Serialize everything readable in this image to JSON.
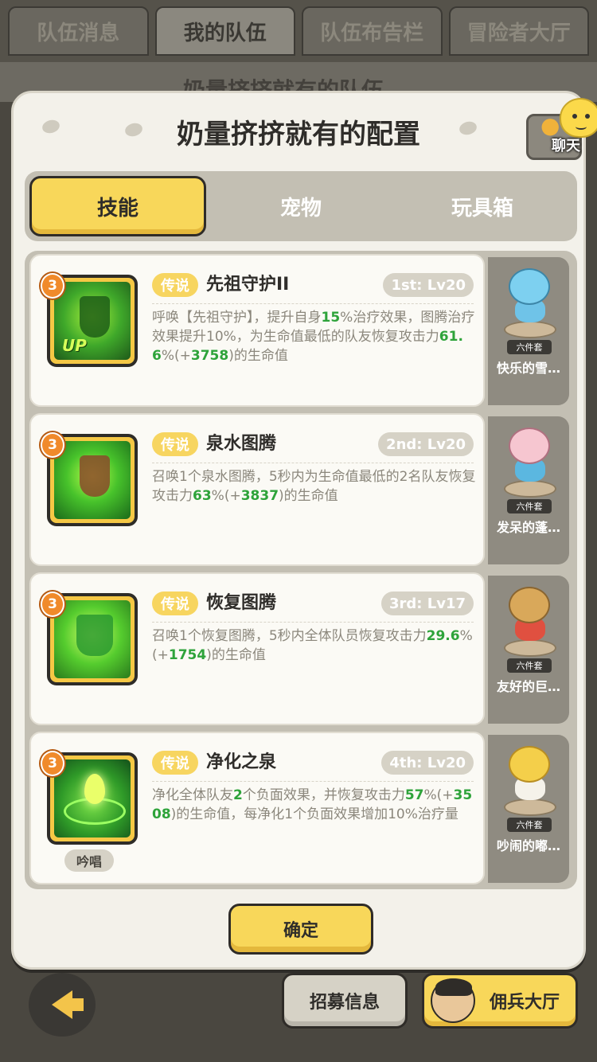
{
  "top_tabs": [
    "队伍消息",
    "我的队伍",
    "队伍布告栏",
    "冒险者大厅"
  ],
  "bg_title": "奶量挤挤就有的队伍",
  "modal": {
    "title": "奶量挤挤就有的配置",
    "chat_label": "聊天"
  },
  "segments": [
    "技能",
    "宠物",
    "玩具箱"
  ],
  "skills": [
    {
      "level": "3",
      "tag": "传说",
      "name": "先祖守护II",
      "order": "1st: Lv20",
      "icon": "ancestor-guard-icon",
      "icon_badge": "UP",
      "desc_parts": [
        "呼唤【先祖守护】，提升自身",
        "15",
        "%治疗效果，图腾治疗效果提升10%，为生命值最低的队友恢复攻击力",
        "61.6",
        "%(+",
        "3758",
        ")的生命值"
      ],
      "pet_name": "快乐的雪…",
      "pet_set": "六件套"
    },
    {
      "level": "3",
      "tag": "传说",
      "name": "泉水图腾",
      "order": "2nd: Lv20",
      "icon": "spring-totem-icon",
      "desc_parts": [
        "召唤1个泉水图腾，5秒内为生命值最低的2名队友恢复攻击力",
        "63",
        "%(+",
        "3837",
        ")的生命值"
      ],
      "pet_name": "发呆的蓬…",
      "pet_set": "六件套"
    },
    {
      "level": "3",
      "tag": "传说",
      "name": "恢复图腾",
      "order": "3rd: Lv17",
      "icon": "recovery-totem-icon",
      "desc_parts": [
        "召唤1个恢复图腾，5秒内全体队员恢复攻击力",
        "29.6",
        "%(+",
        "1754",
        ")的生命值"
      ],
      "pet_name": "友好的巨…",
      "pet_set": "六件套"
    },
    {
      "level": "3",
      "tag": "传说",
      "name": "净化之泉",
      "order": "4th: Lv20",
      "icon": "purify-spring-icon",
      "chant": "吟唱",
      "desc_parts": [
        "净化全体队友",
        "2",
        "个负面效果，并恢复攻击力",
        "57",
        "%(+",
        "3508",
        ")的生命值，每净化1个负面效果增加10%治疗量"
      ],
      "pet_name": "吵闹的嘟…",
      "pet_set": "六件套"
    }
  ],
  "confirm_label": "确定",
  "bottom": {
    "recruit_label": "招募信息",
    "merc_label": "佣兵大厅"
  },
  "colors": {
    "accent_yellow": "#f8d75a",
    "highlight_green": "#2ea33a",
    "tag_yellow": "#f7d560"
  }
}
